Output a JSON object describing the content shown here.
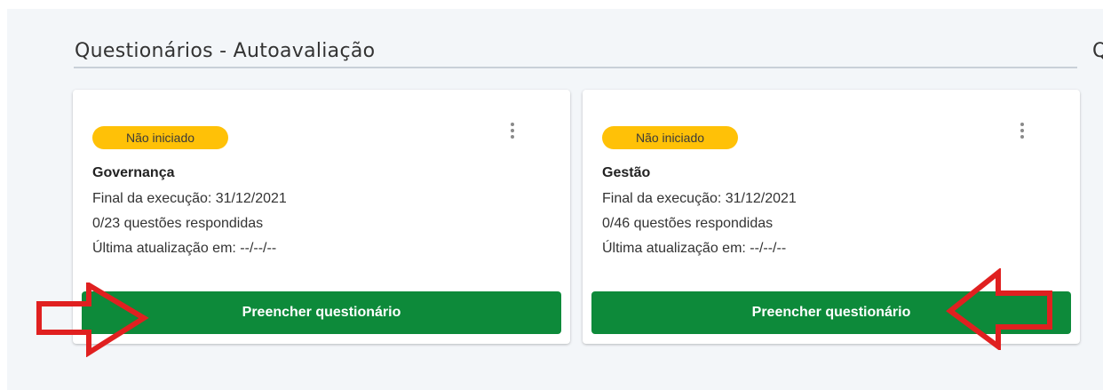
{
  "section": {
    "title": "Questionários - Autoavaliação",
    "next_title_partial": "Q"
  },
  "cards": [
    {
      "status": "Não iniciado",
      "name": "Governança",
      "deadline": "Final da execução: 31/12/2021",
      "progress": "0/23 questões respondidas",
      "updated": "Última atualização em: --/--/--",
      "action": "Preencher questionário"
    },
    {
      "status": "Não iniciado",
      "name": "Gestão",
      "deadline": "Final da execução: 31/12/2021",
      "progress": "0/46 questões respondidas",
      "updated": "Última atualização em: --/--/--",
      "action": "Preencher questionário"
    }
  ],
  "colors": {
    "badge": "#ffc107",
    "button": "#0d8a3a",
    "annotation_arrow": "#e02020"
  },
  "icons": [
    "more-vertical-icon",
    "right-arrow-annotation",
    "left-arrow-annotation"
  ]
}
